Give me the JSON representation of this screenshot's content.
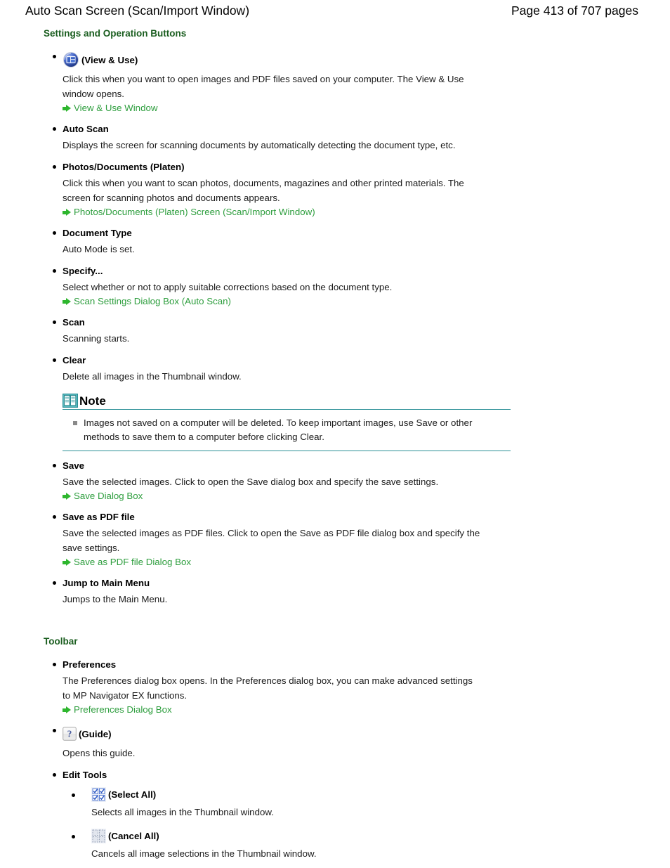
{
  "header": {
    "doc_title": "Auto Scan Screen (Scan/Import Window)",
    "page_number": "Page 413 of 707 pages"
  },
  "colors": {
    "heading_green": "#1b5e20",
    "link_green": "#2e9e3e",
    "arrow_green": "#2eb62e",
    "note_rule_teal": "#2a8f96",
    "icon_blue": "#3a5fc8"
  },
  "sections": [
    {
      "heading": "Settings and Operation Buttons",
      "items": [
        {
          "icon": "view-and-use-icon",
          "title": "(View & Use)",
          "body_lines": [
            "Click this when you want to open images and PDF files saved on your computer. The View & Use",
            "window opens."
          ],
          "links": [
            "View & Use Window"
          ]
        },
        {
          "title": "Auto Scan",
          "body_lines": [
            "Displays the screen for scanning documents by automatically detecting the document type, etc."
          ],
          "links": []
        },
        {
          "title": "Photos/Documents (Platen)",
          "body_lines": [
            "Click this when you want to scan photos, documents, magazines and other printed materials. The",
            "screen for scanning photos and documents appears."
          ],
          "links": [
            "Photos/Documents (Platen) Screen (Scan/Import Window)"
          ]
        },
        {
          "title": "Document Type",
          "body_lines": [
            "Auto Mode is set."
          ],
          "links": []
        },
        {
          "title": "Specify...",
          "body_lines": [
            "Select whether or not to apply suitable corrections based on the document type."
          ],
          "links": [
            "Scan Settings Dialog Box (Auto Scan)"
          ]
        },
        {
          "title": "Scan",
          "body_lines": [
            "Scanning starts."
          ],
          "links": []
        },
        {
          "title": "Clear",
          "body_lines": [
            "Delete all images in the Thumbnail window."
          ],
          "links": []
        }
      ],
      "note": {
        "icon": "book-icon",
        "label": "Note",
        "bullets": [
          "Images not saved on a computer will be deleted. To keep important images, use Save or other methods to save them to a computer before clicking Clear."
        ]
      },
      "items_after_note": [
        {
          "title": "Save",
          "body_lines": [
            "Save the selected images. Click to open the Save dialog box and specify the save settings."
          ],
          "links": [
            "Save Dialog Box"
          ]
        },
        {
          "title": "Save as PDF file",
          "body_lines": [
            "Save the selected images as PDF files. Click to open the Save as PDF file dialog box and specify the",
            "save settings."
          ],
          "links": [
            "Save as PDF file Dialog Box"
          ]
        },
        {
          "title": "Jump to Main Menu",
          "body_lines": [
            "Jumps to the Main Menu."
          ],
          "links": []
        }
      ]
    },
    {
      "heading": "Toolbar",
      "items": [
        {
          "title": "Preferences",
          "body_lines": [
            "The Preferences dialog box opens. In the Preferences dialog box, you can make advanced settings",
            "to MP Navigator EX functions."
          ],
          "links": [
            "Preferences Dialog Box"
          ]
        },
        {
          "icon": "guide-question-icon",
          "title": "(Guide)",
          "body_lines": [
            "Opens this guide."
          ],
          "links": []
        },
        {
          "title": "Edit Tools",
          "body_lines": [],
          "links": [],
          "subitems": [
            {
              "icon": "select-all-icon",
              "title": "(Select All)",
              "body_lines": [
                "Selects all images in the Thumbnail window."
              ]
            },
            {
              "icon": "cancel-all-icon",
              "title": "(Cancel All)",
              "body_lines": [
                "Cancels all image selections in the Thumbnail window."
              ]
            }
          ]
        }
      ]
    }
  ]
}
